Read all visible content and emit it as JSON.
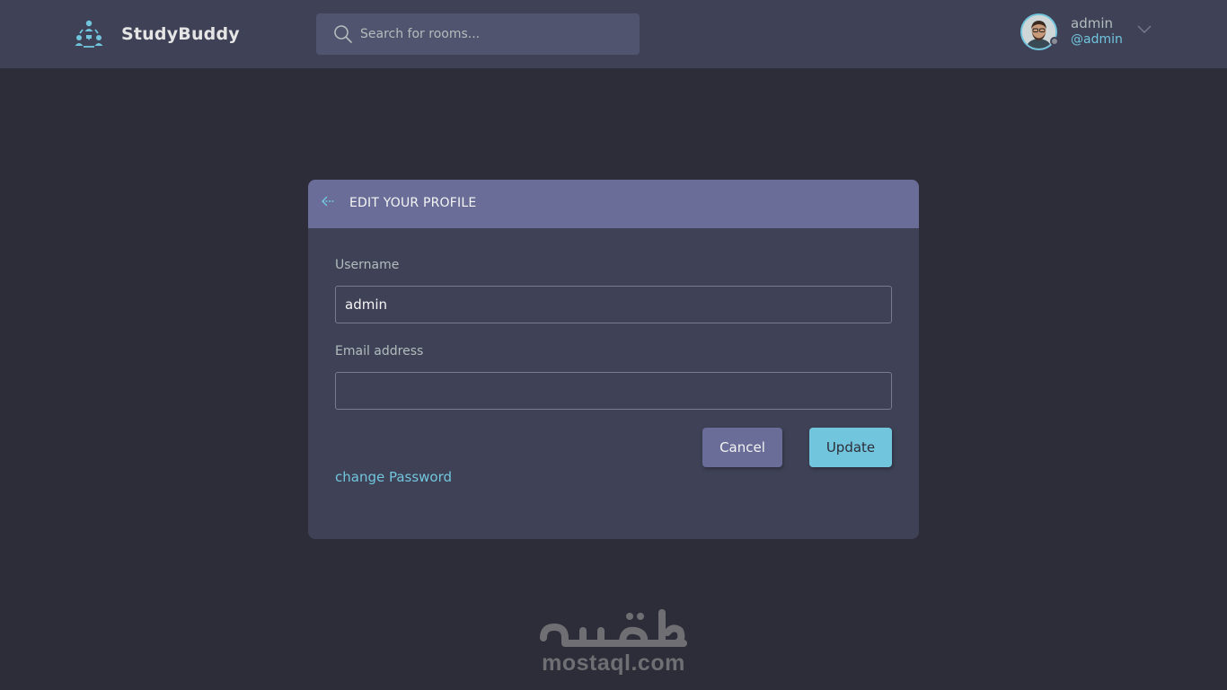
{
  "app": {
    "brand_name": "StudyBuddy",
    "brand_icon": "people-network-icon",
    "accent_color": "#71c6dd",
    "background_color": "#2d2d39",
    "header_color": "#3f4156"
  },
  "search": {
    "placeholder": "Search for rooms...",
    "value": "",
    "icon": "search-icon"
  },
  "user": {
    "name": "admin",
    "handle": "@admin",
    "status": "offline",
    "menu_icon": "chevron-down-icon"
  },
  "edit_profile": {
    "back_icon": "arrow-left-icon",
    "title": "EDIT YOUR PROFILE",
    "header_color": "#696d97",
    "username_label": "Username",
    "username_value": "admin",
    "email_label": "Email address",
    "email_value": "",
    "cancel_label": "Cancel",
    "update_label": "Update",
    "change_password_label": "change Password"
  },
  "watermark": {
    "arabic_text": "مستقل",
    "latin_text": "mostaql.com"
  }
}
